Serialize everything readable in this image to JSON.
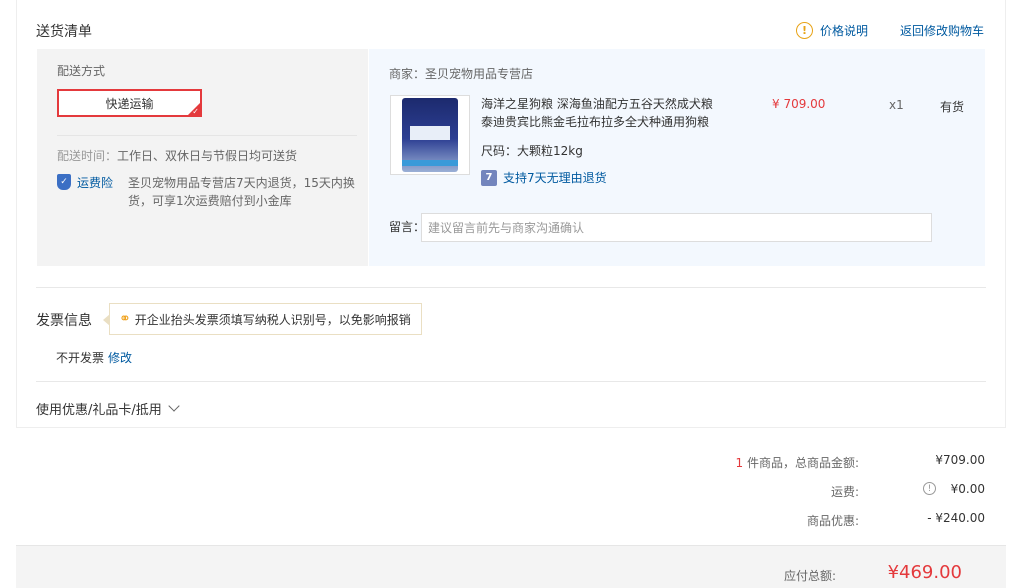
{
  "header": {
    "title": "送货清单",
    "price_note": "价格说明",
    "back_to_cart": "返回修改购物车",
    "warn_icon_glyph": "!"
  },
  "shipping": {
    "method_label": "配送方式",
    "method_option": "快递运输",
    "time_label": "配送时间：",
    "time_value": "工作日、双休日与节假日均可送货",
    "insurance_link": "运费险",
    "insurance_desc": "圣贝宠物用品专营店7天内退货，15天内换货，可享1次运费赔付到小金库"
  },
  "order": {
    "shop": "商家：圣贝宠物用品专营店",
    "product": {
      "title": "海洋之星狗粮 深海鱼油配方五谷天然成犬粮 泰迪贵宾比熊金毛拉布拉多全犬种通用狗粮",
      "price": "¥ 709.00",
      "quantity": "x1",
      "stock": "有货",
      "spec": "尺码：大颗粒12kg",
      "return_policy": "支持7天无理由退货",
      "return_icon_glyph": "7"
    },
    "message_label": "留言：",
    "message_placeholder": "建议留言前先与商家沟通确认"
  },
  "invoice": {
    "title": "发票信息",
    "tip": "开企业抬头发票须填写纳税人识别号，以免影响报销",
    "value": "不开发票",
    "edit": "修改"
  },
  "coupon": {
    "label": "使用优惠/礼品卡/抵用"
  },
  "summary": {
    "count": "1",
    "count_suffix": " 件商品，总商品金额:",
    "goods_total": "¥709.00",
    "freight_label": "运费:",
    "freight_value": "¥0.00",
    "discount_label": "商品优惠:",
    "discount_value": "- ¥240.00",
    "payable_label": "应付总额:",
    "payable_value": "¥469.00"
  },
  "colors": {
    "accent_red": "#e4393c",
    "link_blue": "#005aa0",
    "warning_orange": "#e8a317"
  }
}
